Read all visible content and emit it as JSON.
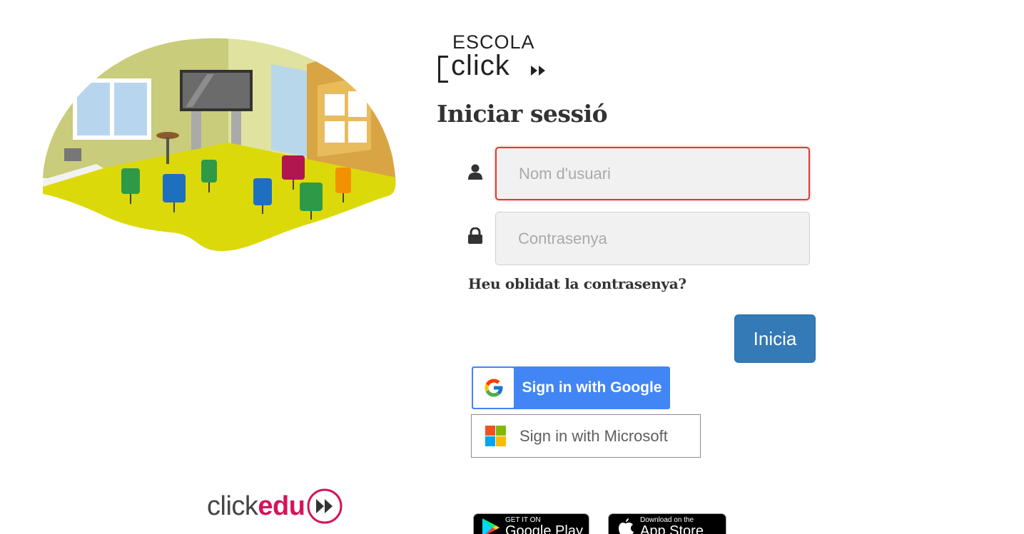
{
  "logo": {
    "top": "ESCOLA",
    "main": "click"
  },
  "form": {
    "title": "Iniciar sessió",
    "username_placeholder": "Nom d'usuari",
    "password_placeholder": "Contrasenya",
    "forgot_link": "Heu oblidat la contrasenya?",
    "submit_label": "Inicia"
  },
  "sso": {
    "google_label": "Sign in with Google",
    "microsoft_label": "Sign in with Microsoft"
  },
  "footer": {
    "brand_click": "click",
    "brand_edu": "edu",
    "google_play_small": "GET IT ON",
    "google_play_big": "Google Play",
    "app_store_small": "Download on the",
    "app_store_big": "App Store"
  },
  "colors": {
    "primary_button": "#337ab7",
    "google_blue": "#4285f4",
    "error_border": "#e53935",
    "brand_pink": "#d4145a"
  },
  "icons": {
    "username": "user-icon",
    "password": "lock-icon"
  }
}
